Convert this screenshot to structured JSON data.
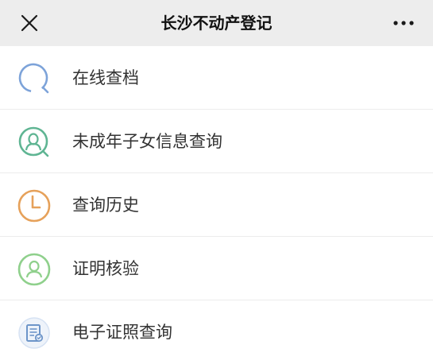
{
  "header": {
    "title": "长沙不动产登记"
  },
  "colors": {
    "blue": "#7da3d9",
    "green": "#5fb593",
    "orange": "#e6a15a",
    "light_green": "#8fd08c",
    "doc_blue": "#6d95c9"
  },
  "menu": {
    "items": [
      {
        "label": "在线查档",
        "icon": "search-icon"
      },
      {
        "label": "未成年子女信息查询",
        "icon": "person-search-icon"
      },
      {
        "label": "查询历史",
        "icon": "clock-icon"
      },
      {
        "label": "证明核验",
        "icon": "person-verify-icon"
      },
      {
        "label": "电子证照查询",
        "icon": "document-icon"
      }
    ]
  }
}
